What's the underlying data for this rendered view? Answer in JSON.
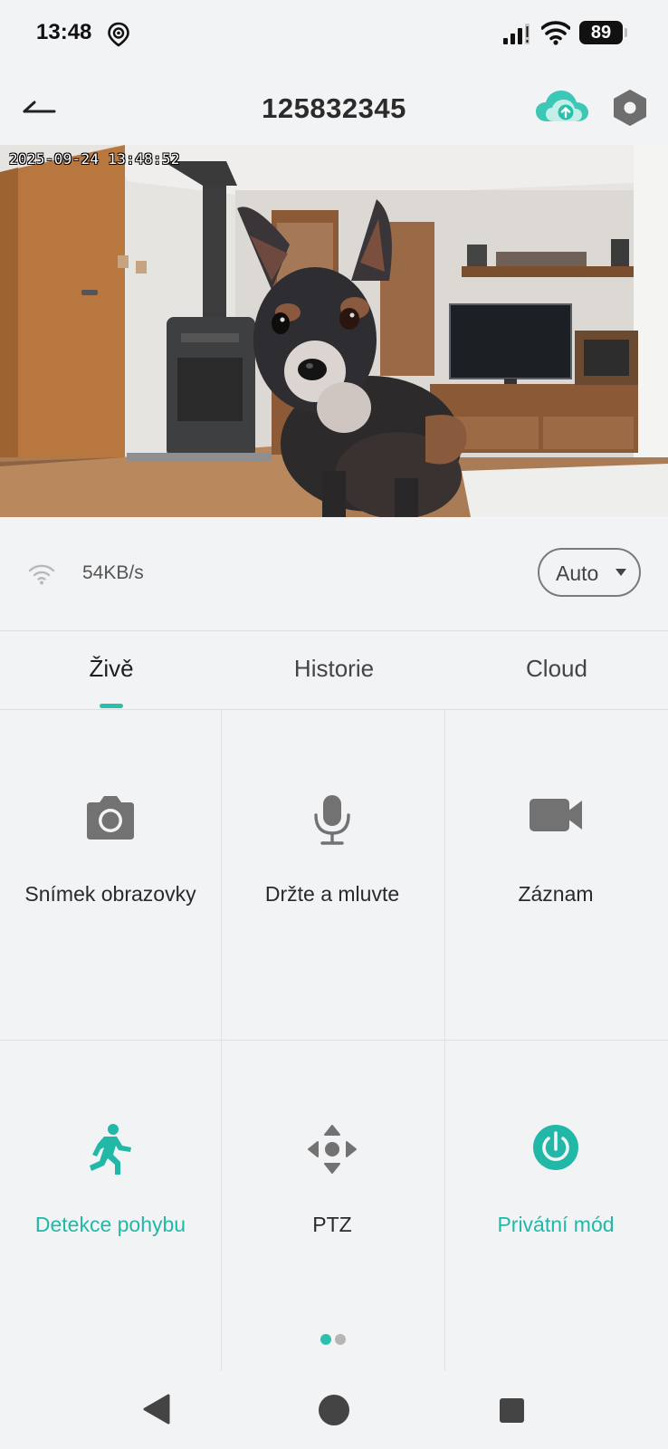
{
  "status_bar": {
    "time": "13:48",
    "battery": "89",
    "icons": [
      "location-pin-icon",
      "signal-icon",
      "wifi-icon",
      "battery-icon"
    ]
  },
  "header": {
    "title": "125832345",
    "icons": [
      "back-arrow-icon",
      "cloud-upload-icon",
      "settings-hexagon-icon"
    ],
    "accent_color": "#2bbfae"
  },
  "video": {
    "timestamp": "2025-09-24 13:48:52"
  },
  "stream": {
    "speed": "54KB/s",
    "quality": "Auto"
  },
  "tabs": [
    {
      "label": "Živě",
      "active": true
    },
    {
      "label": "Historie",
      "active": false
    },
    {
      "label": "Cloud",
      "active": false
    }
  ],
  "controls": [
    {
      "label": "Snímek obrazovky",
      "icon": "camera-icon"
    },
    {
      "label": "Držte a mluvte",
      "icon": "microphone-icon"
    },
    {
      "label": "Záznam",
      "icon": "video-camera-icon"
    },
    {
      "label": "Detekce pohybu",
      "icon": "running-person-icon",
      "active": true
    },
    {
      "label": "PTZ",
      "icon": "directional-pad-icon"
    },
    {
      "label": "Privátní mód",
      "icon": "power-icon",
      "active": true
    }
  ],
  "pager": {
    "pages": 2,
    "current": 1
  },
  "nav": {
    "icons": [
      "nav-back-icon",
      "nav-home-icon",
      "nav-recent-icon"
    ]
  }
}
